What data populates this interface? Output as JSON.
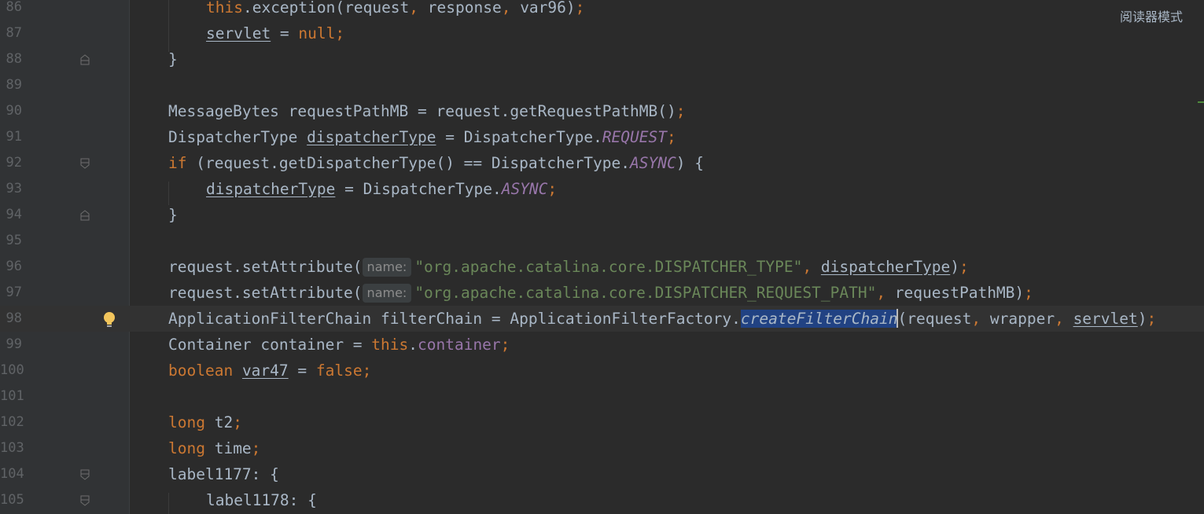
{
  "reader_mode_label": "阅读器模式",
  "colors": {
    "background": "#2b2b2b",
    "gutter": "#313335",
    "keyword": "#cc7832",
    "string": "#6a8759",
    "field": "#9876aa",
    "text": "#a9b7c6",
    "selection": "#214283"
  },
  "lines": [
    {
      "num": "86",
      "parts": [
        "this",
        ".exception(request",
        ", ",
        "response",
        ", ",
        "var96)",
        ";"
      ]
    },
    {
      "num": "87",
      "parts": [
        "servlet",
        " = ",
        "null",
        ";"
      ]
    },
    {
      "num": "88",
      "parts": [
        "}"
      ]
    },
    {
      "num": "89",
      "parts": []
    },
    {
      "num": "90",
      "parts": [
        "MessageBytes requestPathMB = request.getRequestPathMB()",
        ";"
      ]
    },
    {
      "num": "91",
      "parts": [
        "DispatcherType ",
        "dispatcherType",
        " = DispatcherType.",
        "REQUEST",
        ";"
      ]
    },
    {
      "num": "92",
      "parts": [
        "if",
        " (request.getDispatcherType() == DispatcherType.",
        "ASYNC",
        ") {"
      ]
    },
    {
      "num": "93",
      "parts": [
        "dispatcherType",
        " = DispatcherType.",
        "ASYNC",
        ";"
      ]
    },
    {
      "num": "94",
      "parts": [
        "}"
      ]
    },
    {
      "num": "95",
      "parts": []
    },
    {
      "num": "96",
      "parts": [
        "request.setAttribute(",
        "name:",
        "\"org.apache.catalina.core.DISPATCHER_TYPE\"",
        ", ",
        "dispatcherType",
        ")",
        ";"
      ]
    },
    {
      "num": "97",
      "parts": [
        "request.setAttribute(",
        "name:",
        "\"org.apache.catalina.core.DISPATCHER_REQUEST_PATH\"",
        ", ",
        "requestPathMB)",
        ";"
      ]
    },
    {
      "num": "98",
      "parts": [
        "ApplicationFilterChain filterChain = ApplicationFilterFactory.",
        "createFilterChain",
        "(request",
        ", ",
        "wrapper",
        ", ",
        "servlet",
        ")",
        ";"
      ]
    },
    {
      "num": "99",
      "parts": [
        "Container container = ",
        "this",
        ".",
        "container",
        ";"
      ]
    },
    {
      "num": "100",
      "parts": [
        "boolean",
        " ",
        "var47",
        " = ",
        "false",
        ";"
      ]
    },
    {
      "num": "101",
      "parts": []
    },
    {
      "num": "102",
      "parts": [
        "long",
        " t2",
        ";"
      ]
    },
    {
      "num": "103",
      "parts": [
        "long",
        " time",
        ";"
      ]
    },
    {
      "num": "104",
      "parts": [
        "label1177: {"
      ]
    },
    {
      "num": "105",
      "parts": [
        "label1178: {"
      ]
    }
  ]
}
